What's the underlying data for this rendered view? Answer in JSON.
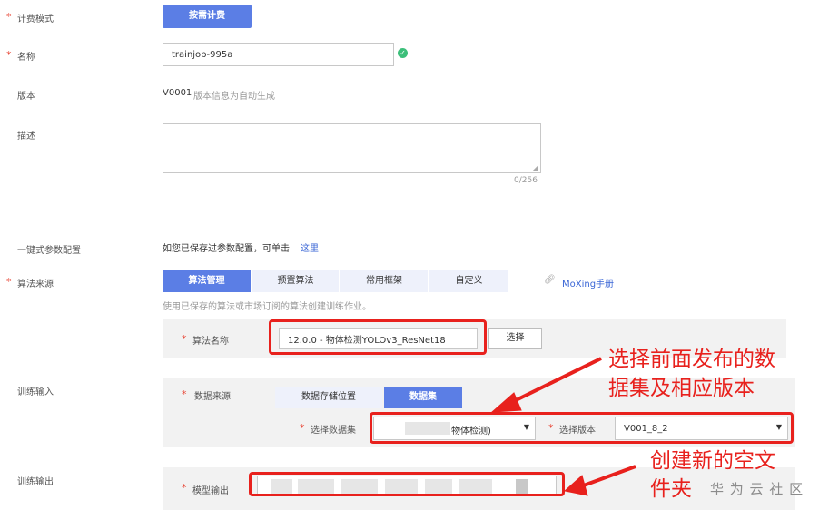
{
  "billing": {
    "label": "计费模式",
    "button": "按需计费"
  },
  "name": {
    "label": "名称",
    "value": "trainjob-995a"
  },
  "version": {
    "label": "版本",
    "value": "V0001",
    "hint": "版本信息为自动生成"
  },
  "description": {
    "label": "描述",
    "counter": "0/256"
  },
  "one_click": {
    "label": "一键式参数配置",
    "text": "如您已保存过参数配置，可单击",
    "link": "这里"
  },
  "algo_source": {
    "label": "算法来源",
    "tabs": [
      "算法管理",
      "预置算法",
      "常用框架",
      "自定义"
    ],
    "moxing_link": "MoXing手册",
    "hint": "使用已保存的算法或市场订阅的算法创建训练作业。",
    "algo_name_label": "算法名称",
    "algo_name_value": "12.0.0 - 物体检测YOLOv3_ResNet18",
    "select_button": "选择"
  },
  "train_input": {
    "label": "训练输入",
    "data_source_label": "数据来源",
    "tabs": [
      "数据存储位置",
      "数据集"
    ],
    "dataset_label": "选择数据集",
    "dataset_value": "物体检测)",
    "version_label": "选择版本",
    "version_value": "V001_8_2"
  },
  "train_output": {
    "label": "训练输出",
    "model_output_label": "模型输出"
  },
  "annotations": {
    "dataset_note_line1": "选择前面发布的数",
    "dataset_note_line2": "据集及相应版本",
    "output_note_line1": "创建新的空文",
    "output_note_line2": "件夹"
  },
  "watermark": "华 为 云 社 区",
  "colors": {
    "primary": "#5b7ee5",
    "required": "#e84a3a",
    "annotation": "#e8211d",
    "success": "#3cbf7a"
  }
}
